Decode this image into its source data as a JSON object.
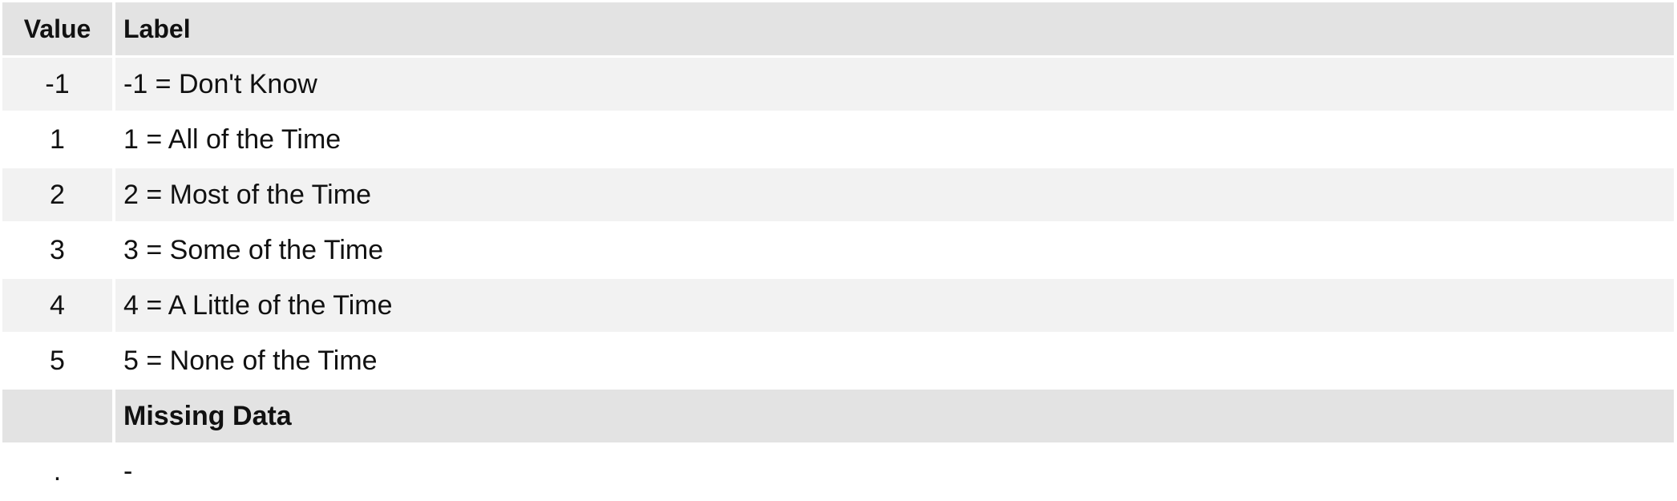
{
  "table": {
    "headers": {
      "value": "Value",
      "label": "Label"
    },
    "rows": [
      {
        "value": "-1",
        "label": "-1 = Don't Know"
      },
      {
        "value": "1",
        "label": "1 = All of the Time"
      },
      {
        "value": "2",
        "label": "2 = Most of the Time"
      },
      {
        "value": "3",
        "label": "3 = Some of the Time"
      },
      {
        "value": "4",
        "label": "4 = A Little of the Time"
      },
      {
        "value": "5",
        "label": "5 = None of the Time"
      }
    ],
    "missing_section": {
      "title": "Missing Data",
      "rows": [
        {
          "value": ".",
          "label": "-"
        }
      ]
    }
  },
  "colors": {
    "header_bg": "#e3e3e3",
    "stripe_bg": "#f2f2f2",
    "row_bg": "#ffffff"
  }
}
